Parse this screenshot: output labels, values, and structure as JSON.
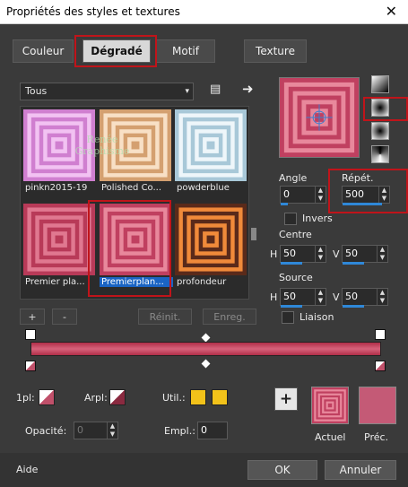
{
  "window": {
    "title": "Propriétés des styles et textures",
    "close": "✕"
  },
  "tabs": [
    "Couleur",
    "Dégradé",
    "Motif",
    "Texture"
  ],
  "category": {
    "value": "Tous",
    "arrow": "▾"
  },
  "gallery": [
    {
      "label": "pinkn2015-19",
      "colors": [
        "#d07fd0",
        "#f2c2f2"
      ]
    },
    {
      "label": "Polished Co...",
      "colors": [
        "#d4a070",
        "#f8e0c6"
      ]
    },
    {
      "label": "powderblue",
      "colors": [
        "#a8c8d8",
        "#eef6fa"
      ]
    },
    {
      "label": "Premier pla...",
      "colors": [
        "#b83a58",
        "#e07890"
      ]
    },
    {
      "label": "Premierplan...",
      "colors": [
        "#c04060",
        "#e8889c"
      ]
    },
    {
      "label": "profondeur",
      "colors": [
        "#5a2a1a",
        "#f08a3a"
      ]
    }
  ],
  "watermark": "Renée Graphisme",
  "buttons": {
    "plus": "+",
    "minus": "-",
    "reinit": "Réinit.",
    "enreg": "Enreg.",
    "add": "+"
  },
  "angle": {
    "label": "Angle",
    "value": "0"
  },
  "repet": {
    "label": "Répét.",
    "value": "500"
  },
  "inverse": {
    "label": "Invers"
  },
  "centre": {
    "label": "Centre",
    "h_label": "H",
    "h": "50",
    "v_label": "V",
    "v": "50"
  },
  "source": {
    "label": "Source",
    "h_label": "H",
    "h": "50",
    "v_label": "V",
    "v": "50"
  },
  "liaison": {
    "label": "Liaison"
  },
  "lower": {
    "pl_label": "1pl:",
    "arpl_label": "Arpl:",
    "util_label": "Util.:",
    "opacite_label": "Opacité:",
    "opacite_value": "0",
    "empl_label": "Empl.:",
    "empl_value": "0",
    "actuel_label": "Actuel",
    "prec_label": "Préc."
  },
  "footer": {
    "help": "Aide",
    "ok": "OK",
    "cancel": "Annuler"
  },
  "colors": {
    "accent": "#c0141a",
    "grad_start": "#b02e48",
    "grad_end": "#d7627b",
    "util": "#f2c21a"
  }
}
